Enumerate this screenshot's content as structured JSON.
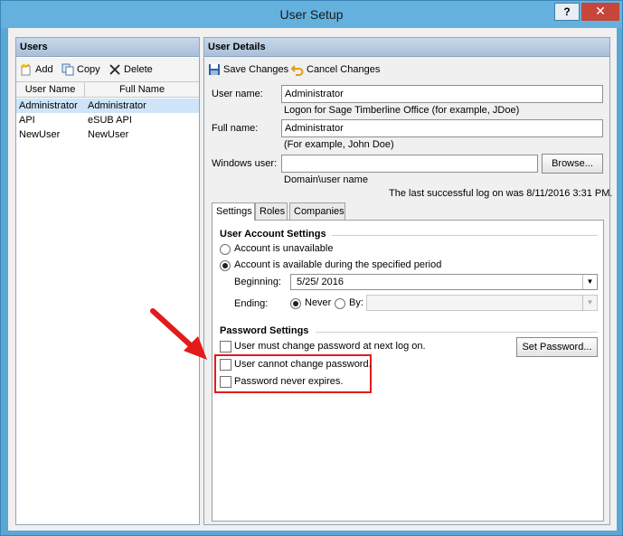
{
  "window": {
    "title": "User Setup",
    "help_label": "?",
    "close_label": "✕"
  },
  "users_panel": {
    "title": "Users",
    "toolbar": {
      "add": "Add",
      "copy": "Copy",
      "delete": "Delete"
    },
    "columns": [
      "User Name",
      "Full Name"
    ],
    "rows": [
      {
        "user": "Administrator",
        "full": "Administrator",
        "selected": true
      },
      {
        "user": "API",
        "full": "eSUB API",
        "selected": false
      },
      {
        "user": "NewUser",
        "full": "NewUser",
        "selected": false
      }
    ]
  },
  "details": {
    "title": "User Details",
    "toolbar": {
      "save": "Save Changes",
      "cancel": "Cancel Changes"
    },
    "username_label": "User name:",
    "username_value": "Administrator",
    "username_hint": "Logon for Sage Timberline Office (for example, JDoe)",
    "fullname_label": "Full name:",
    "fullname_value": "Administrator",
    "fullname_hint": "(For example, John Doe)",
    "windows_label": "Windows user:",
    "windows_value": "",
    "windows_hint": "Domain\\user name",
    "browse": "Browse...",
    "last_logon": "The last successful log on was 8/11/2016 3:31 PM.",
    "tabs": [
      "Settings",
      "Roles",
      "Companies"
    ],
    "settings": {
      "account_section": "User Account Settings",
      "unavailable": "Account is unavailable",
      "available_period": "Account is available during the specified period",
      "beginning_label": "Beginning:",
      "beginning_value": "5/25/ 2016",
      "ending_label": "Ending:",
      "never": "Never",
      "by": "By:",
      "password_section": "Password Settings",
      "must_change": "User must change password at next log on.",
      "cannot_change": "User cannot change password.",
      "never_expires": "Password never expires.",
      "set_password": "Set Password..."
    }
  },
  "colors": {
    "annotation": "#e21b1b",
    "selection": "#cfe4f8",
    "title_bar": "#64b1de"
  }
}
